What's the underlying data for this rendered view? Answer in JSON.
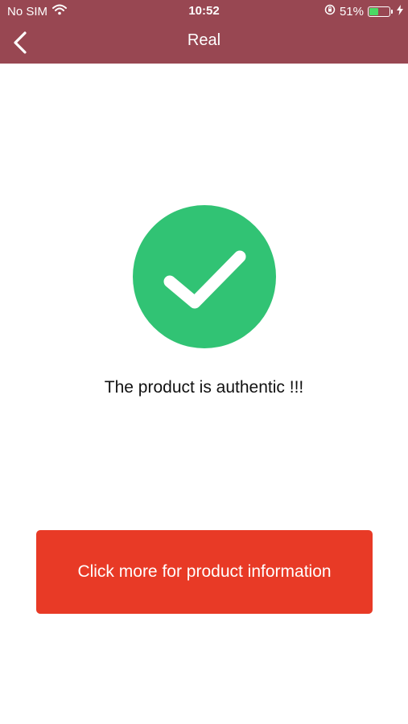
{
  "status_bar": {
    "carrier": "No SIM",
    "time": "10:52",
    "battery_percent": "51%",
    "battery_level": 0.51,
    "icons": [
      "wifi-icon",
      "orientation-lock-icon",
      "battery-icon",
      "charging-bolt-icon"
    ]
  },
  "nav": {
    "title": "Real",
    "back_icon": "chevron-left-icon"
  },
  "result": {
    "icon": "check-circle-icon",
    "message": "The product is authentic !!!"
  },
  "cta": {
    "label": "Click more for product information"
  },
  "colors": {
    "header_bg": "#984752",
    "check_green": "#31c374",
    "cta_red": "#e83a26",
    "battery_green": "#4cd964"
  }
}
